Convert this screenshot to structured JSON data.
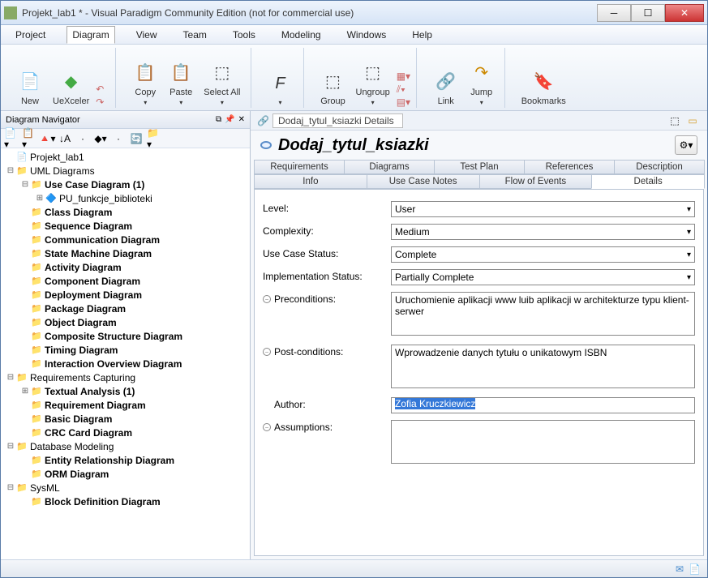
{
  "window": {
    "title": "Projekt_lab1 * - Visual Paradigm Community Edition (not for commercial use)"
  },
  "menubar": [
    "Project",
    "Diagram",
    "View",
    "Team",
    "Tools",
    "Modeling",
    "Windows",
    "Help"
  ],
  "menubar_active": 1,
  "ribbon": {
    "new": "New",
    "uexceler": "UeXceler",
    "copy": "Copy",
    "paste": "Paste",
    "selectall": "Select All",
    "group": "Group",
    "ungroup": "Ungroup",
    "link": "Link",
    "jump": "Jump",
    "bookmarks": "Bookmarks"
  },
  "navigator": {
    "title": "Diagram Navigator"
  },
  "tree": [
    {
      "indent": 0,
      "toggle": "",
      "icon": "📄",
      "label": "Projekt_lab1",
      "bold": false
    },
    {
      "indent": 0,
      "toggle": "⊟",
      "icon": "📁",
      "label": "UML Diagrams",
      "bold": false
    },
    {
      "indent": 1,
      "toggle": "⊟",
      "icon": "📁",
      "label": "Use Case Diagram (1)",
      "bold": true
    },
    {
      "indent": 2,
      "toggle": "⊞",
      "icon": "🔷",
      "label": "PU_funkcje_biblioteki",
      "bold": false
    },
    {
      "indent": 1,
      "toggle": "",
      "icon": "📁",
      "label": "Class Diagram",
      "bold": true
    },
    {
      "indent": 1,
      "toggle": "",
      "icon": "📁",
      "label": "Sequence Diagram",
      "bold": true
    },
    {
      "indent": 1,
      "toggle": "",
      "icon": "📁",
      "label": "Communication Diagram",
      "bold": true
    },
    {
      "indent": 1,
      "toggle": "",
      "icon": "📁",
      "label": "State Machine Diagram",
      "bold": true
    },
    {
      "indent": 1,
      "toggle": "",
      "icon": "📁",
      "label": "Activity Diagram",
      "bold": true
    },
    {
      "indent": 1,
      "toggle": "",
      "icon": "📁",
      "label": "Component Diagram",
      "bold": true
    },
    {
      "indent": 1,
      "toggle": "",
      "icon": "📁",
      "label": "Deployment Diagram",
      "bold": true
    },
    {
      "indent": 1,
      "toggle": "",
      "icon": "📁",
      "label": "Package Diagram",
      "bold": true
    },
    {
      "indent": 1,
      "toggle": "",
      "icon": "📁",
      "label": "Object Diagram",
      "bold": true
    },
    {
      "indent": 1,
      "toggle": "",
      "icon": "📁",
      "label": "Composite Structure Diagram",
      "bold": true
    },
    {
      "indent": 1,
      "toggle": "",
      "icon": "📁",
      "label": "Timing Diagram",
      "bold": true
    },
    {
      "indent": 1,
      "toggle": "",
      "icon": "📁",
      "label": "Interaction Overview Diagram",
      "bold": true
    },
    {
      "indent": 0,
      "toggle": "⊟",
      "icon": "📁",
      "label": "Requirements Capturing",
      "bold": false
    },
    {
      "indent": 1,
      "toggle": "⊞",
      "icon": "📁",
      "label": "Textual Analysis (1)",
      "bold": true
    },
    {
      "indent": 1,
      "toggle": "",
      "icon": "📁",
      "label": "Requirement Diagram",
      "bold": true
    },
    {
      "indent": 1,
      "toggle": "",
      "icon": "📁",
      "label": "Basic Diagram",
      "bold": true
    },
    {
      "indent": 1,
      "toggle": "",
      "icon": "📁",
      "label": "CRC Card Diagram",
      "bold": true
    },
    {
      "indent": 0,
      "toggle": "⊟",
      "icon": "📁",
      "label": "Database Modeling",
      "bold": false
    },
    {
      "indent": 1,
      "toggle": "",
      "icon": "📁",
      "label": "Entity Relationship Diagram",
      "bold": true
    },
    {
      "indent": 1,
      "toggle": "",
      "icon": "📁",
      "label": "ORM Diagram",
      "bold": true
    },
    {
      "indent": 0,
      "toggle": "⊟",
      "icon": "📁",
      "label": "SysML",
      "bold": false
    },
    {
      "indent": 1,
      "toggle": "",
      "icon": "📁",
      "label": "Block Definition Diagram",
      "bold": true
    }
  ],
  "breadcrumb": {
    "item": "Dodaj_tytul_ksiazki Details"
  },
  "detail": {
    "title": "Dodaj_tytul_ksiazki"
  },
  "tabs_row1": [
    "Requirements",
    "Diagrams",
    "Test Plan",
    "References",
    "Description"
  ],
  "tabs_row2": [
    "Info",
    "Use Case Notes",
    "Flow of Events",
    "Details"
  ],
  "tabs_active": "Details",
  "form": {
    "level_label": "Level:",
    "level_value": "User",
    "complexity_label": "Complexity:",
    "complexity_value": "Medium",
    "usecasestatus_label": "Use Case Status:",
    "usecasestatus_value": "Complete",
    "implstatus_label": "Implementation Status:",
    "implstatus_value": "Partially Complete",
    "preconditions_label": "Preconditions:",
    "preconditions_value": "Uruchomienie aplikacji www luib aplikacji w architekturze typu klient-serwer",
    "postconditions_label": "Post-conditions:",
    "postconditions_value": "Wprowadzenie danych tytułu o unikatowym ISBN",
    "author_label": "Author:",
    "author_value": "Zofia Kruczkiewicz",
    "assumptions_label": "Assumptions:",
    "assumptions_value": ""
  }
}
